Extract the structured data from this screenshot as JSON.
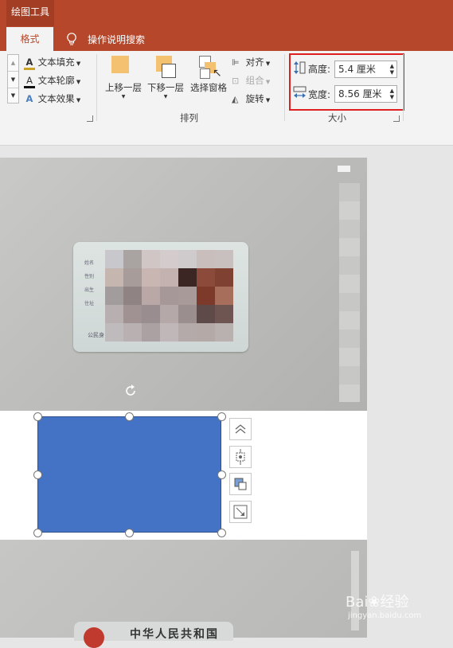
{
  "titlebar": {
    "context_tab": "绘图工具"
  },
  "tabs": {
    "format": "格式",
    "tell_me": "操作说明搜索"
  },
  "wordart": {
    "fill": "文本填充",
    "outline": "文本轮廓",
    "effects": "文本效果"
  },
  "arrange": {
    "bring_forward": "上移一层",
    "send_backward": "下移一层",
    "selection_pane": "选择窗格",
    "align": "对齐",
    "group": "组合",
    "rotate": "旋转",
    "group_label": "排列"
  },
  "size": {
    "height_label": "高度:",
    "height_value": "5.4 厘米",
    "width_label": "宽度:",
    "width_value": "8.56 厘米",
    "group_label": "大小"
  },
  "card_fields": [
    "姓名",
    "性别",
    "出生",
    "住址",
    "公民身"
  ],
  "bottom_card_text": "中华人民共和国",
  "watermark": {
    "brand": "Bai",
    "brand2": "经验",
    "url": "jingyan.baidu.com"
  },
  "colors": {
    "accent": "#b7472a",
    "shape_fill": "#4472c4",
    "highlight": "#e02020"
  }
}
